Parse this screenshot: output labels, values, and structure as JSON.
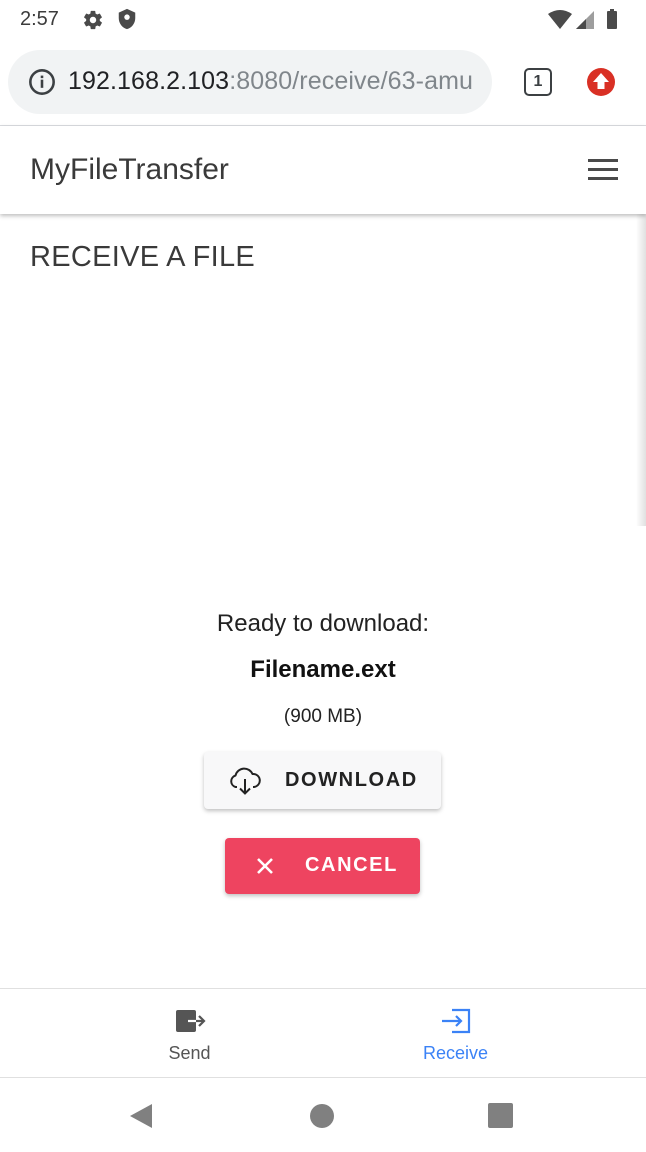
{
  "status_bar": {
    "time": "2:57",
    "icons": [
      "gear-icon",
      "shield-icon",
      "wifi-icon",
      "signal-icon",
      "battery-icon"
    ]
  },
  "browser": {
    "url_host": "192.168.2.103",
    "url_rest": ":8080/receive/63-amu",
    "tab_count": "1",
    "icons": [
      "info-icon",
      "update-arrow-icon"
    ]
  },
  "app": {
    "title": "MyFileTransfer"
  },
  "page": {
    "heading": "RECEIVE A FILE",
    "ready_label": "Ready to download:",
    "file_name": "Filename.ext",
    "file_size": "(900 MB)"
  },
  "actions": {
    "download_label": "DOWNLOAD",
    "cancel_label": "CANCEL"
  },
  "bottom_nav": {
    "items": [
      {
        "label": "Send",
        "icon": "send-icon",
        "active": false
      },
      {
        "label": "Receive",
        "icon": "receive-icon",
        "active": true
      }
    ]
  },
  "colors": {
    "accent": "#3b82f6",
    "cancel": "#ee4460",
    "update_badge": "#d93025"
  }
}
